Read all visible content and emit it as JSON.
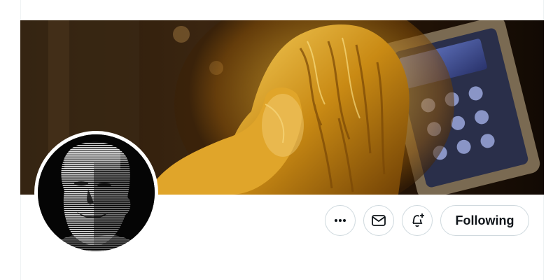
{
  "profile": {
    "banner": {
      "description_icon": "banner-image",
      "accent_colors": [
        "#c9901a",
        "#f2c04a",
        "#8a5a0a",
        "#1a0f05"
      ]
    },
    "avatar": {
      "icon": "avatar-portrait",
      "background": "#050505"
    },
    "actions": {
      "more_icon": "more-horizontal-icon",
      "message_icon": "envelope-icon",
      "notify_icon": "bell-plus-icon",
      "following_label": "Following"
    }
  },
  "colors": {
    "border": "#cfd9de",
    "text": "#0f1419",
    "background": "#ffffff"
  }
}
